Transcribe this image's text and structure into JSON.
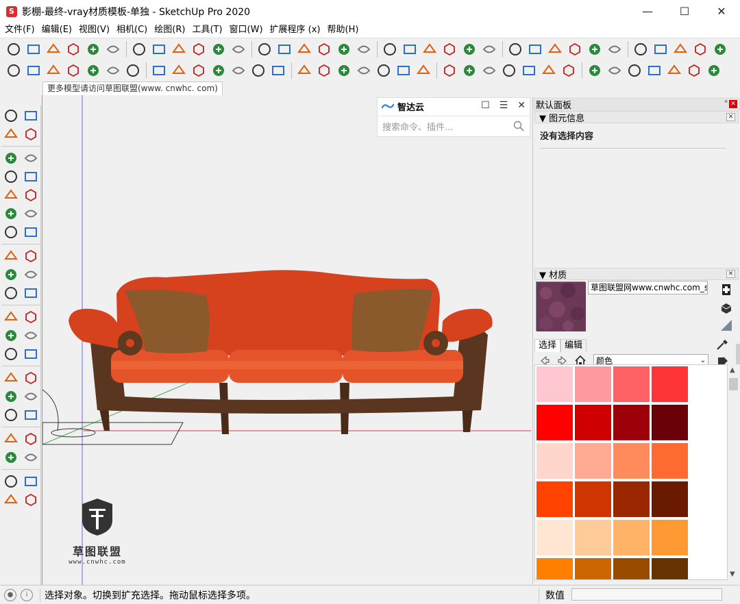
{
  "window": {
    "title": "影棚-最终-vray材质模板-单独 - SketchUp Pro 2020",
    "controls": [
      "—",
      "☐",
      "✕"
    ]
  },
  "menu": [
    "文件(F)",
    "编辑(E)",
    "视图(V)",
    "相机(C)",
    "绘图(R)",
    "工具(T)",
    "窗口(W)",
    "扩展程序 (x)",
    "帮助(H)"
  ],
  "document_tab": "更多模型请访问草图联盟(www. cnwhc. com)",
  "zhida": {
    "title": "智达云",
    "search_placeholder": "搜索命令、插件...",
    "brand_color": "#2b8be6"
  },
  "watermark": {
    "title": "草图联盟",
    "url": "www.cnwhc.com"
  },
  "right_panel": {
    "title": "默认面板",
    "pin": "ᵒ",
    "entity_info": {
      "header": "▼ 图元信息",
      "message": "没有选择内容"
    },
    "materials": {
      "header": "▼ 材质",
      "name": "草图联盟网www.cnwhc.com_sE",
      "tabs": [
        "选择",
        "编辑"
      ],
      "category": "颜色",
      "swatches": [
        "#ffc7cf",
        "#ff9aa0",
        "#ff6165",
        "#ff3437",
        "#ff0000",
        "#d00000",
        "#9d0008",
        "#6a0008",
        "#ffd6cc",
        "#ffab94",
        "#ff8a5c",
        "#ff6a33",
        "#ff4200",
        "#cf3500",
        "#9a2700",
        "#6a1a00",
        "#ffe6d3",
        "#ffcc99",
        "#ffb366",
        "#ff9933",
        "#ff8000",
        "#cc6600",
        "#994c00",
        "#663300"
      ]
    }
  },
  "status": {
    "message": "选择对象。切换到扩充选择。拖动鼠标选择多项。",
    "value_label": "数值"
  },
  "icons": {
    "toolbar1": [
      "follow-me-icon",
      "lookaround-icon",
      "teapot-icon",
      "hand-icon",
      "orbit-icon",
      "rotate-icon",
      "section-icon",
      "section-fill-icon",
      "window-icon",
      "camera-view-icon",
      "photo-icon",
      "lock-icon",
      "import-icon",
      "layers-icon",
      "paint-bucket-icon",
      "gear-icon",
      "circle-arc-icon",
      "select-region-icon",
      "shadow-icon",
      "cube-icon",
      "cube2-icon",
      "sphere-icon",
      "sphere2-icon",
      "camera-icon",
      "cloud-icon",
      "cloud2-icon",
      "frame-icon",
      "hex-icon",
      "ring-icon",
      "cylinder-icon",
      "z-axis-icon",
      "sun-icon",
      "eye-icon",
      "red-eye-icon",
      "camera-record-icon"
    ],
    "toolbar2": [
      "house-icon",
      "home-icon",
      "home-outline-icon",
      "home2-icon",
      "house2-icon",
      "brand-e-icon",
      "refresh-icon",
      "select-tool-icon",
      "plus-circle-icon",
      "tree-icon",
      "checker-icon",
      "cloud-up-icon",
      "gear2-icon",
      "mail-icon",
      "info-icon",
      "building-icon",
      "triangle-icon",
      "circle-target-icon",
      "angle-icon",
      "t-icon",
      "starburst-icon",
      "dome-icon",
      "box-icon",
      "crosshair-icon",
      "cube-blue-icon",
      "cube-blue2-icon",
      "cube-blue3-icon",
      "roof-icon",
      "box2-icon",
      "box3-icon",
      "grass-icon",
      "wall-icon",
      "grid-icon",
      "play-icon",
      "pause-icon"
    ]
  }
}
